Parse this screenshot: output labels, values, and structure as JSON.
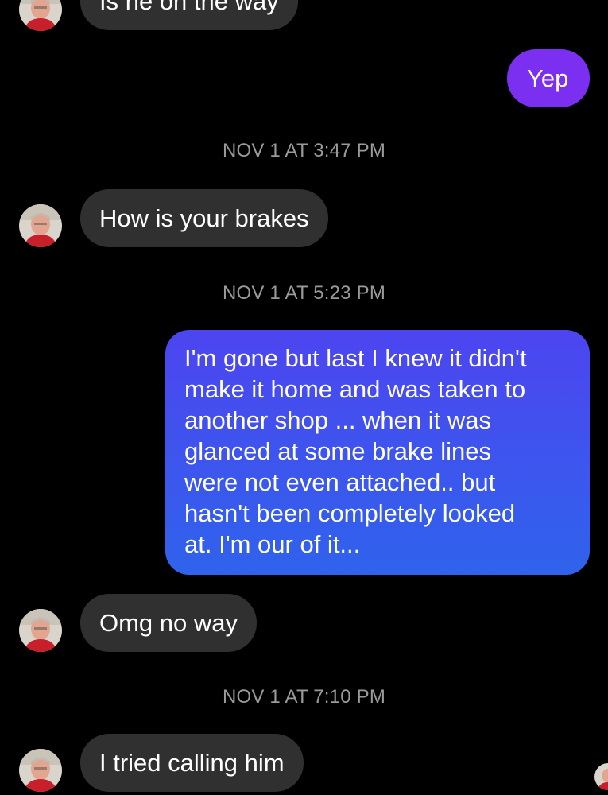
{
  "colors": {
    "background": "#000000",
    "incoming_bubble": "#303030",
    "outgoing_single": "#7b2ff0",
    "outgoing_gradient_top": "#4d45f0",
    "outgoing_gradient_bottom": "#2f63ec",
    "timestamp_text": "#9a9a9a"
  },
  "messages": [
    {
      "direction": "in",
      "text": "Is he on the way",
      "avatar": "contact-avatar"
    },
    {
      "direction": "out",
      "text": "Yep"
    },
    {
      "type": "timestamp",
      "text": "NOV 1 AT 3:47 PM"
    },
    {
      "direction": "in",
      "text": "How is your brakes",
      "avatar": "contact-avatar"
    },
    {
      "type": "timestamp",
      "text": "NOV 1 AT 5:23 PM"
    },
    {
      "direction": "out",
      "lines": [
        "I'm gone but last I knew it didn't",
        "make it home and was taken to",
        "another shop ... when it was",
        "glanced at some brake lines",
        "were not even attached.. but",
        "hasn't been completely looked",
        "at. I'm our of it..."
      ]
    },
    {
      "direction": "in",
      "text": "Omg no way",
      "avatar": "contact-avatar"
    },
    {
      "type": "timestamp",
      "text": "NOV 1 AT 7:10 PM"
    },
    {
      "direction": "in",
      "text": "I tried calling him",
      "avatar": "contact-avatar"
    }
  ],
  "read_receipt": {
    "icon": "contact-avatar-read-receipt"
  }
}
